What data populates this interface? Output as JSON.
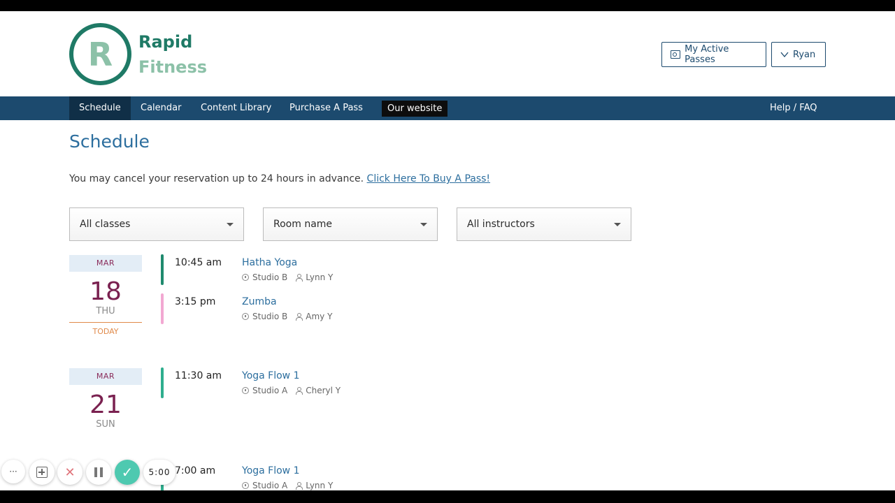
{
  "brand": {
    "logo_letter": "R",
    "line1": "Rapid",
    "line2": "Fitness"
  },
  "header": {
    "passes_label": "My Active Passes",
    "user_label": "Ryan"
  },
  "nav": {
    "items": [
      "Schedule",
      "Calendar",
      "Content Library",
      "Purchase A Pass",
      "Our website"
    ],
    "active": "Schedule",
    "help": "Help / FAQ"
  },
  "page": {
    "title": "Schedule",
    "notice": "You may cancel your reservation up to 24 hours in advance.",
    "notice_link": "Click Here To Buy A Pass!"
  },
  "filters": {
    "classes": "All classes",
    "room": "Room name",
    "instructors": "All instructors"
  },
  "days": [
    {
      "month": "MAR",
      "date": "18",
      "weekday": "THU",
      "today_label": "TODAY",
      "classes": [
        {
          "time": "10:45 am",
          "name": "Hatha Yoga",
          "room": "Studio B",
          "instructor": "Lynn Y",
          "color": "#1f8a6e"
        },
        {
          "time": "3:15 pm",
          "name": "Zumba",
          "room": "Studio B",
          "instructor": "Amy Y",
          "color": "#f2a8d2"
        }
      ]
    },
    {
      "month": "MAR",
      "date": "21",
      "weekday": "SUN",
      "classes": [
        {
          "time": "11:30 am",
          "name": "Yoga Flow 1",
          "room": "Studio A",
          "instructor": "Cheryl Y",
          "color": "#2fae8e"
        }
      ]
    },
    {
      "classes": [
        {
          "time": "7:00 am",
          "name": "Yoga Flow 1",
          "room": "Studio A",
          "instructor": "Lynn Y",
          "color": "#2fae8e"
        }
      ]
    }
  ],
  "recorder": {
    "more": "···",
    "cancel": "✕",
    "done": "✓",
    "timer": "5:00"
  },
  "colors": {
    "brand_green": "#1f7a66",
    "nav_blue": "#1c4a6e",
    "link_blue": "#2c6e9e"
  }
}
